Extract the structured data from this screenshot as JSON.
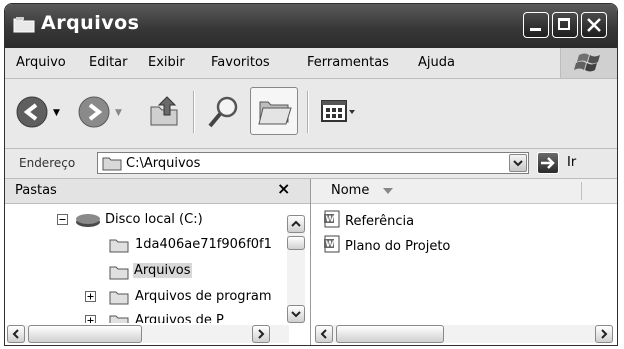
{
  "window": {
    "title": "Arquivos"
  },
  "menu": {
    "items": [
      {
        "label": "Arquivo"
      },
      {
        "label": "Editar"
      },
      {
        "label": "Exibir"
      },
      {
        "label": "Favoritos"
      },
      {
        "label": "Ferramentas"
      },
      {
        "label": "Ajuda"
      }
    ]
  },
  "toolbar": {
    "buttons": [
      "back-icon",
      "forward-icon",
      "up-folder-icon",
      "search-icon",
      "folders-icon",
      "views-icon"
    ]
  },
  "address": {
    "label": "Endereço",
    "value": "C:\\Arquivos",
    "go_label": "Ir"
  },
  "folders_pane": {
    "title": "Pastas",
    "close": "×",
    "tree": [
      {
        "label": "Disco local (C:)",
        "expander": "−"
      },
      {
        "label": "1da406ae71f906f0f1"
      },
      {
        "label": "Arquivos",
        "selected": true
      },
      {
        "label": "Arquivos de program",
        "expander": "+"
      },
      {
        "label": "Arquivos de P",
        "expander": "+"
      }
    ]
  },
  "files_pane": {
    "column": "Nome",
    "files": [
      {
        "name": "Referência",
        "icon": "word-document-icon"
      },
      {
        "name": "Plano do Projeto",
        "icon": "word-document-icon"
      }
    ]
  },
  "colors": {
    "titlebar": "#3a3a3a",
    "window_bg": "#ececec",
    "selection": "#d8d8d8"
  }
}
